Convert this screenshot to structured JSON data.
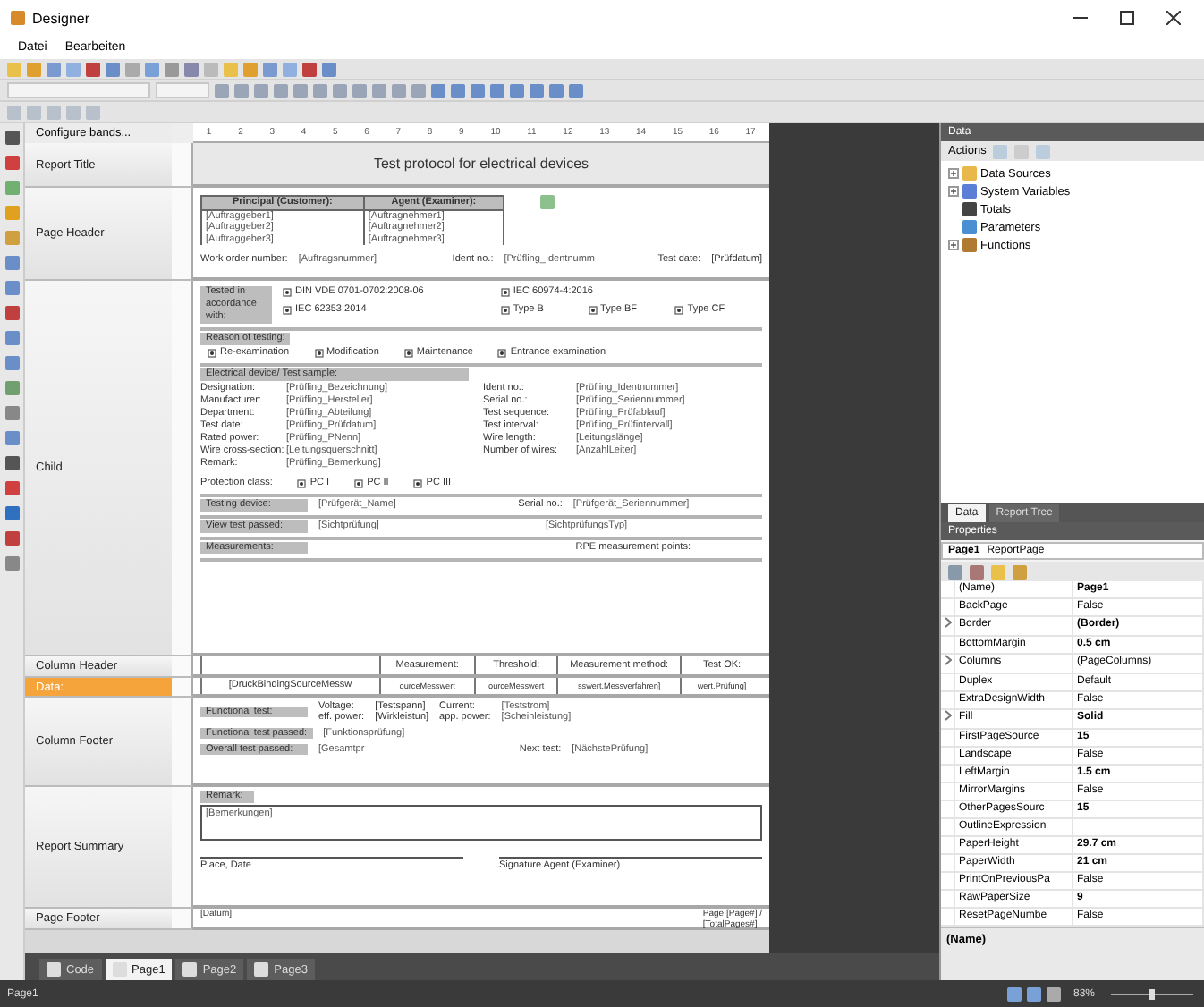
{
  "window": {
    "title": "Designer"
  },
  "menu": [
    "Datei",
    "Bearbeiten"
  ],
  "bands_button": "Configure bands...",
  "ruler": [
    "1",
    "2",
    "3",
    "4",
    "5",
    "6",
    "7",
    "8",
    "9",
    "10",
    "11",
    "12",
    "13",
    "14",
    "15",
    "16",
    "17"
  ],
  "bands": [
    {
      "kind": "report_title",
      "label": "Report Title",
      "selected": false,
      "title": "Test protocol for electrical devices"
    },
    {
      "kind": "page_header",
      "label": "Page Header",
      "selected": false,
      "table": {
        "columns": [
          "Principal (Customer):",
          "Agent (Examiner):"
        ],
        "rows": [
          [
            "[Auftraggeber1]",
            "[Auftragnehmer1]"
          ],
          [
            "[Auftraggeber2]",
            "[Auftragnehmer2]"
          ],
          [
            "[Auftraggeber3]",
            "[Auftragnehmer3]"
          ]
        ]
      },
      "line": [
        {
          "text": "Work order number:",
          "kind": "label"
        },
        {
          "text": "[Auftragsnummer]",
          "kind": "field"
        },
        {
          "text": "Ident no.:",
          "kind": "label"
        },
        {
          "text": "[Prüfling_Identnumm",
          "kind": "field"
        },
        {
          "text": "Test date:",
          "kind": "label"
        },
        {
          "text": "[Prüfdatum]",
          "kind": "label"
        }
      ]
    },
    {
      "kind": "child",
      "label": "Child",
      "selected": false,
      "sections": [
        {
          "kind": "standards",
          "heading": "Tested in accordance with:",
          "options": [
            "DIN VDE 0701-0702:2008-06",
            "IEC 60974-4:2016",
            "IEC 62353:2014",
            "Type B",
            "Type BF",
            "Type CF"
          ]
        },
        {
          "kind": "options",
          "heading": "Reason of testing:",
          "options": [
            "Re-examination",
            "Modification",
            "Maintenance",
            "Entrance examination"
          ]
        },
        {
          "kind": "device",
          "heading": "Electrical device/ Test sample:",
          "left": [
            {
              "label": "Designation:",
              "value": "[Prüfling_Bezeichnung]"
            },
            {
              "label": "Manufacturer:",
              "value": "[Prüfling_Hersteller]"
            },
            {
              "label": "Department:",
              "value": "[Prüfling_Abteilung]"
            },
            {
              "label": "Test date:",
              "value": "[Prüfling_Prüfdatum]"
            },
            {
              "label": "Rated power:",
              "value": "[Prüfling_PNenn]"
            },
            {
              "label": "Wire cross-section:",
              "value": "[Leitungsquerschnitt]"
            },
            {
              "label": "Remark:",
              "value": "[Prüfling_Bemerkung]"
            }
          ],
          "right": [
            {
              "label": "Ident no.:",
              "value": "[Prüfling_Identnummer]"
            },
            {
              "label": "Serial no.:",
              "value": "[Prüfling_Seriennummer]"
            },
            {
              "label": "Test sequence:",
              "value": "[Prüfling_Prüfablauf]"
            },
            {
              "label": "Test interval:",
              "value": "[Prüfling_Prüfintervall]"
            },
            {
              "label": "Wire length:",
              "value": "[Leitungslänge]"
            },
            {
              "label": "Number of wires:",
              "value": "[AnzahlLeiter]"
            }
          ],
          "protection": {
            "label": "Protection class:",
            "options": [
              "PC I",
              "PC II",
              "PC III"
            ]
          }
        },
        {
          "kind": "line",
          "items": [
            {
              "text": "Testing device:",
              "kind": "shaded"
            },
            {
              "text": "[Prüfgerät_Name]",
              "kind": "field"
            },
            {
              "text": "Serial no.:",
              "kind": "label"
            },
            {
              "text": "[Prüfgerät_Seriennummer]",
              "kind": "field"
            }
          ]
        },
        {
          "kind": "line",
          "items": [
            {
              "text": "View test passed:",
              "kind": "shaded"
            },
            {
              "text": "[Sichtprüfung]",
              "kind": "field"
            },
            {
              "text": "[SichtprüfungsTyp]",
              "kind": "field"
            }
          ]
        },
        {
          "kind": "line",
          "items": [
            {
              "text": "Measurements:",
              "kind": "shaded"
            },
            {
              "text": "RPE measurement points:",
              "kind": "right"
            }
          ]
        }
      ]
    },
    {
      "kind": "column_header",
      "label": "Column Header",
      "selected": false,
      "cells": [
        "Measurement:",
        "Threshold:",
        "Measurement method:",
        "Test OK:"
      ]
    },
    {
      "kind": "data",
      "label": "Data:",
      "selected": true,
      "cells": [
        "[DruckBindingSourceMessw",
        "ourceMesswert",
        "ourceMesswert",
        "sswert.Messverfahren]",
        "wert.Prüfung]"
      ]
    },
    {
      "kind": "column_footer",
      "label": "Column Footer",
      "selected": false,
      "lines": [
        [
          {
            "text": "Functional test:",
            "kind": "shaded"
          },
          {
            "text": "Voltage:\neff. power:",
            "kind": "label"
          },
          {
            "text": "[Testspann]\n[Wirkleistun]",
            "kind": "label"
          },
          {
            "text": "Current:\napp. power:",
            "kind": "label"
          },
          {
            "text": "[Teststrom]\n[Scheinleistung]",
            "kind": "field"
          }
        ],
        [
          {
            "text": "Functional test passed:",
            "kind": "shaded"
          },
          {
            "text": "[Funktionsprüfung]",
            "kind": "field"
          }
        ],
        [
          {
            "text": "Overall test passed:",
            "kind": "shaded"
          },
          {
            "text": "[Gesamtpr",
            "kind": "field"
          },
          {
            "text": "Next test:",
            "kind": "label"
          },
          {
            "text": "[NächstePrüfung]",
            "kind": "field"
          }
        ]
      ]
    },
    {
      "kind": "summary",
      "label": "Report Summary",
      "selected": false,
      "heading": "Remark:",
      "memo": "[Bemerkungen]",
      "signatures": [
        "Place, Date",
        "Signature Agent (Examiner)"
      ]
    },
    {
      "kind": "page_footer",
      "label": "Page Footer",
      "selected": false,
      "items": [
        "[Datum]",
        "Page [Page#] /\n[TotalPages#]"
      ]
    }
  ],
  "data_panel": {
    "title": "Data",
    "actions": "Actions",
    "tree": [
      {
        "label": "Data Sources",
        "kind": "folder",
        "expandable": true
      },
      {
        "label": "System Variables",
        "kind": "variables",
        "expandable": true
      },
      {
        "label": "Totals",
        "kind": "sigma",
        "expandable": false
      },
      {
        "label": "Parameters",
        "kind": "parameters",
        "expandable": false
      },
      {
        "label": "Functions",
        "kind": "function",
        "expandable": true
      }
    ],
    "tabs": [
      {
        "label": "Data",
        "selected": true
      },
      {
        "label": "Report Tree",
        "selected": false
      }
    ]
  },
  "properties": {
    "title": "Properties",
    "object": "Page1",
    "object_type": "ReportPage",
    "rows": [
      {
        "name": "(Name)",
        "value": "Page1",
        "bold": true,
        "expandable": false
      },
      {
        "name": "BackPage",
        "value": "False",
        "bold": false,
        "expandable": false
      },
      {
        "name": "Border",
        "value": "(Border)",
        "bold": true,
        "expandable": true
      },
      {
        "name": "BottomMargin",
        "value": "0.5 cm",
        "bold": true,
        "expandable": false
      },
      {
        "name": "Columns",
        "value": "(PageColumns)",
        "bold": false,
        "expandable": true
      },
      {
        "name": "Duplex",
        "value": "Default",
        "bold": false,
        "expandable": false
      },
      {
        "name": "ExtraDesignWidth",
        "value": "False",
        "bold": false,
        "expandable": false
      },
      {
        "name": "Fill",
        "value": "Solid",
        "bold": true,
        "expandable": true
      },
      {
        "name": "FirstPageSource",
        "value": "15",
        "bold": true,
        "expandable": false
      },
      {
        "name": "Landscape",
        "value": "False",
        "bold": false,
        "expandable": false
      },
      {
        "name": "LeftMargin",
        "value": "1.5 cm",
        "bold": true,
        "expandable": false
      },
      {
        "name": "MirrorMargins",
        "value": "False",
        "bold": false,
        "expandable": false
      },
      {
        "name": "OtherPagesSourc",
        "value": "15",
        "bold": true,
        "expandable": false
      },
      {
        "name": "OutlineExpression",
        "bold": false,
        "expandable": false
      },
      {
        "name": "PaperHeight",
        "value": "29.7 cm",
        "bold": true,
        "expandable": false
      },
      {
        "name": "PaperWidth",
        "value": "21 cm",
        "bold": true,
        "expandable": false
      },
      {
        "name": "PrintOnPreviousPa",
        "value": "False",
        "bold": false,
        "expandable": false
      },
      {
        "name": "RawPaperSize",
        "value": "9",
        "bold": true,
        "expandable": false
      },
      {
        "name": "ResetPageNumbe",
        "value": "False",
        "bold": false,
        "expandable": false
      }
    ],
    "description": "(Name)"
  },
  "page_tabs": [
    {
      "label": "Code",
      "selected": false
    },
    {
      "label": "Page1",
      "selected": true
    },
    {
      "label": "Page2",
      "selected": false
    },
    {
      "label": "Page3",
      "selected": false
    }
  ],
  "status": {
    "text": "Page1",
    "zoom": "83%",
    "level": 0.5
  }
}
